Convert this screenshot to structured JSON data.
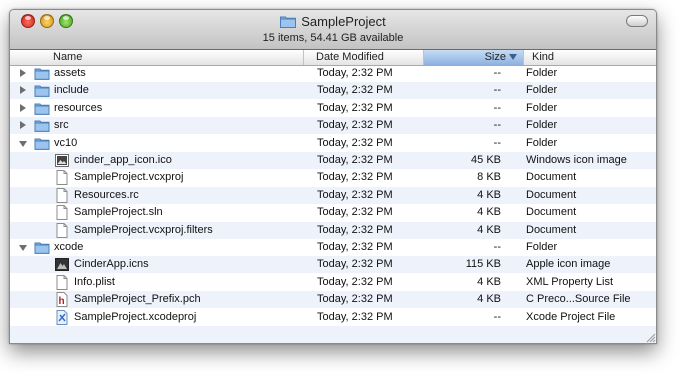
{
  "window": {
    "title": "SampleProject",
    "status": "15 items, 54.41 GB available"
  },
  "columns": {
    "name": "Name",
    "date": "Date Modified",
    "size": "Size",
    "kind": "Kind"
  },
  "rows": [
    {
      "name": "assets",
      "date": "Today, 2:32 PM",
      "size": "--",
      "kind": "Folder",
      "level": 0,
      "expander": "closed",
      "icon": "folder-icon"
    },
    {
      "name": "include",
      "date": "Today, 2:32 PM",
      "size": "--",
      "kind": "Folder",
      "level": 0,
      "expander": "closed",
      "icon": "folder-icon"
    },
    {
      "name": "resources",
      "date": "Today, 2:32 PM",
      "size": "--",
      "kind": "Folder",
      "level": 0,
      "expander": "closed",
      "icon": "folder-icon"
    },
    {
      "name": "src",
      "date": "Today, 2:32 PM",
      "size": "--",
      "kind": "Folder",
      "level": 0,
      "expander": "closed",
      "icon": "folder-icon"
    },
    {
      "name": "vc10",
      "date": "Today, 2:32 PM",
      "size": "--",
      "kind": "Folder",
      "level": 0,
      "expander": "open",
      "icon": "folder-icon"
    },
    {
      "name": "cinder_app_icon.ico",
      "date": "Today, 2:32 PM",
      "size": "45 KB",
      "kind": "Windows icon image",
      "level": 1,
      "expander": "none",
      "icon": "image-file-icon"
    },
    {
      "name": "SampleProject.vcxproj",
      "date": "Today, 2:32 PM",
      "size": "8 KB",
      "kind": "Document",
      "level": 1,
      "expander": "none",
      "icon": "document-icon"
    },
    {
      "name": "Resources.rc",
      "date": "Today, 2:32 PM",
      "size": "4 KB",
      "kind": "Document",
      "level": 1,
      "expander": "none",
      "icon": "document-icon"
    },
    {
      "name": "SampleProject.sln",
      "date": "Today, 2:32 PM",
      "size": "4 KB",
      "kind": "Document",
      "level": 1,
      "expander": "none",
      "icon": "document-icon"
    },
    {
      "name": "SampleProject.vcxproj.filters",
      "date": "Today, 2:32 PM",
      "size": "4 KB",
      "kind": "Document",
      "level": 1,
      "expander": "none",
      "icon": "document-icon"
    },
    {
      "name": "xcode",
      "date": "Today, 2:32 PM",
      "size": "--",
      "kind": "Folder",
      "level": 0,
      "expander": "open",
      "icon": "folder-icon"
    },
    {
      "name": "CinderApp.icns",
      "date": "Today, 2:32 PM",
      "size": "115 KB",
      "kind": "Apple icon image",
      "level": 1,
      "expander": "none",
      "icon": "icns-file-icon"
    },
    {
      "name": "Info.plist",
      "date": "Today, 2:32 PM",
      "size": "4 KB",
      "kind": "XML Property List",
      "level": 1,
      "expander": "none",
      "icon": "document-icon"
    },
    {
      "name": "SampleProject_Prefix.pch",
      "date": "Today, 2:32 PM",
      "size": "4 KB",
      "kind": "C Preco...Source File",
      "level": 1,
      "expander": "none",
      "icon": "header-file-icon"
    },
    {
      "name": "SampleProject.xcodeproj",
      "date": "Today, 2:32 PM",
      "size": "--",
      "kind": "Xcode Project File",
      "level": 1,
      "expander": "none",
      "icon": "xcode-project-icon"
    }
  ],
  "colors": {
    "selected_column": "#8cb1e0",
    "row_stripe": "#eef3fb",
    "folder": "#7fb0e6"
  }
}
